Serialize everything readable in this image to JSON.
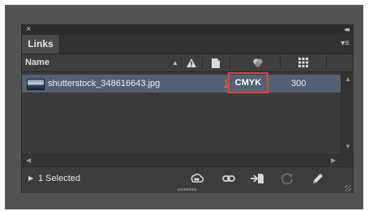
{
  "panel": {
    "close_glyph": "×",
    "collapse_glyph": "◂◂",
    "tab_label": "Links",
    "menu_glyph": "▾≡"
  },
  "table": {
    "columns": [
      "Name",
      "",
      "",
      "",
      ""
    ],
    "sort_glyph": "▴",
    "rows": [
      {
        "name": "shutterstock_348616643.jpg",
        "page": "1",
        "color_space": "CMYK",
        "ppi": "300"
      }
    ]
  },
  "footer": {
    "disclosure_glyph": "▶",
    "selection_status": "1 Selected"
  },
  "icons": {
    "warning": "warning-icon",
    "page": "page-icon",
    "color_space": "color-space-icon",
    "resolution": "resolution-icon",
    "relink_cc": "relink-cc-icon",
    "relink": "relink-icon",
    "goto_link": "go-to-link-icon",
    "update_link": "update-link-icon",
    "edit_original": "edit-original-icon"
  },
  "colors": {
    "panel_bg": "#3a3a3a",
    "selected_row": "#536174",
    "highlight_box": "#e2432d",
    "page_link": "#e0782b"
  }
}
